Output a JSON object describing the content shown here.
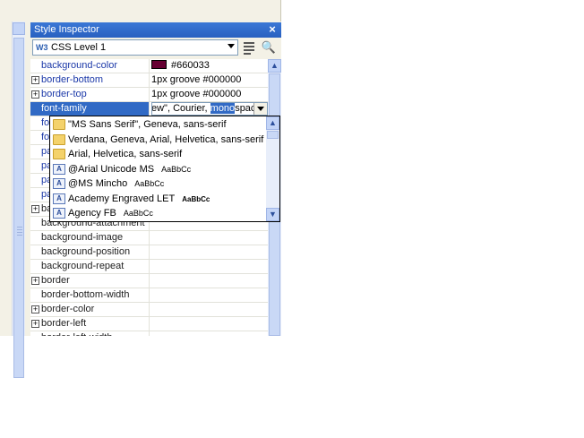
{
  "inspector": {
    "title": "Style Inspector",
    "close_icon": "close-icon",
    "css_level": "CSS Level 1"
  },
  "properties": [
    {
      "name": "background-color",
      "value": "#660033",
      "swatch": "#660033",
      "set": true,
      "expander": false
    },
    {
      "name": "border-bottom",
      "value": "1px groove #000000",
      "set": true,
      "expander": true
    },
    {
      "name": "border-top",
      "value": "1px groove #000000",
      "set": true,
      "expander": true
    },
    {
      "name": "font-family",
      "value": "",
      "set": true,
      "expander": false,
      "selected": true
    },
    {
      "name": "fon",
      "value": "",
      "set": true,
      "expander": false
    },
    {
      "name": "fon",
      "value": "",
      "set": true,
      "expander": false
    },
    {
      "name": "pa",
      "value": "",
      "set": true,
      "expander": false
    },
    {
      "name": "pa",
      "value": "",
      "set": true,
      "expander": false
    },
    {
      "name": "pa",
      "value": "",
      "set": true,
      "expander": false
    },
    {
      "name": "pa",
      "value": "",
      "set": true,
      "expander": false
    },
    {
      "name": "ba",
      "value": "",
      "set": false,
      "expander": true
    },
    {
      "name": "background-attachment",
      "value": "",
      "set": false,
      "expander": false
    },
    {
      "name": "background-image",
      "value": "",
      "set": false,
      "expander": false
    },
    {
      "name": "background-position",
      "value": "",
      "set": false,
      "expander": false
    },
    {
      "name": "background-repeat",
      "value": "",
      "set": false,
      "expander": false
    },
    {
      "name": "border",
      "value": "",
      "set": false,
      "expander": true
    },
    {
      "name": "border-bottom-width",
      "value": "",
      "set": false,
      "expander": false
    },
    {
      "name": "border-color",
      "value": "",
      "set": false,
      "expander": true
    },
    {
      "name": "border-left",
      "value": "",
      "set": false,
      "expander": true
    },
    {
      "name": "border-left-width",
      "value": "",
      "set": false,
      "expander": false
    }
  ],
  "edit_cell": {
    "before": "ew\", Courier, ",
    "highlighted": "mono",
    "after": "space"
  },
  "font_options": [
    {
      "label": "\"MS Sans Serif\", Geneva, sans-serif",
      "icon": "folder-icon",
      "sample": ""
    },
    {
      "label": "Verdana, Geneva, Arial, Helvetica, sans-serif",
      "icon": "folder-icon",
      "sample": ""
    },
    {
      "label": "Arial, Helvetica, sans-serif",
      "icon": "folder-icon",
      "sample": ""
    },
    {
      "label": "@Arial Unicode MS",
      "icon": "font-icon",
      "sample": "AaBbCc"
    },
    {
      "label": "@MS Mincho",
      "icon": "font-icon",
      "sample": "AaBbCc"
    },
    {
      "label": "Academy Engraved LET",
      "icon": "font-icon",
      "sample": "AaBbCc"
    },
    {
      "label": "Agency FB",
      "icon": "font-icon",
      "sample": "AaBbCc"
    }
  ],
  "colors": {
    "title_bar": "#316ac5",
    "selection": "#316ac5",
    "set_property": "#1b38a8",
    "swatch": "#660033"
  }
}
